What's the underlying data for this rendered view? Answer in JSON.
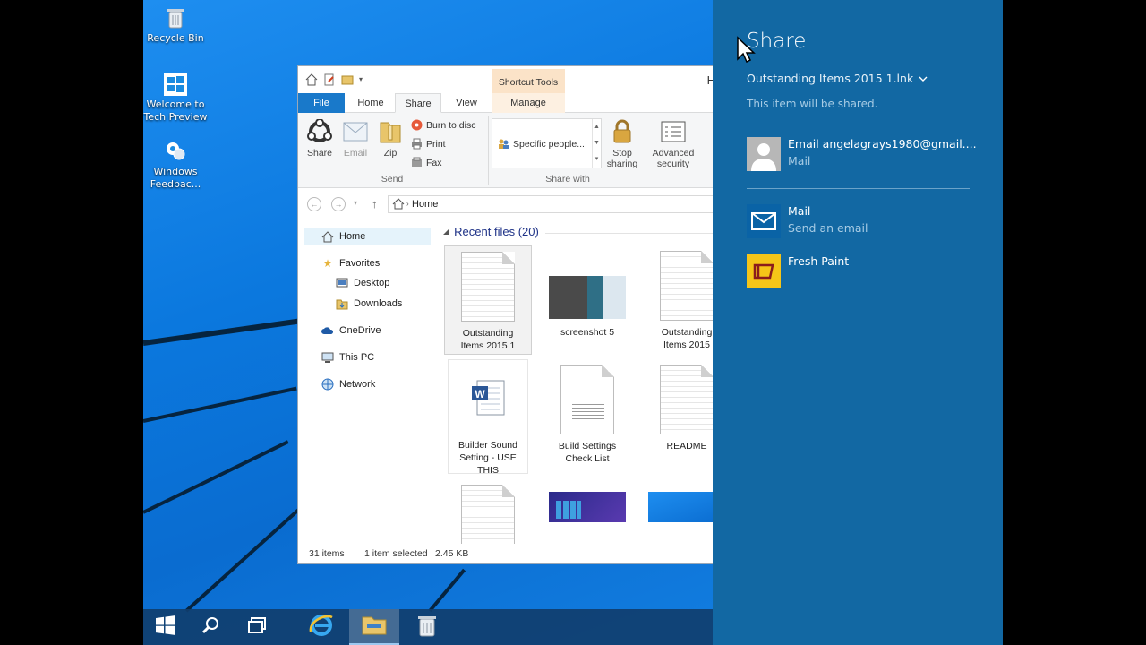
{
  "desktop": {
    "icons": [
      {
        "label": "Recycle Bin",
        "icon": "recycle-bin-icon"
      },
      {
        "label": "Welcome to Tech Preview",
        "icon": "windows-logo-icon"
      },
      {
        "label": "Windows Feedbac...",
        "icon": "feedback-icon"
      }
    ]
  },
  "explorer": {
    "context_tab": "Shortcut Tools",
    "title_partial": "H",
    "tabs": {
      "file": "File",
      "home": "Home",
      "share": "Share",
      "view": "View",
      "manage": "Manage"
    },
    "ribbon": {
      "share": "Share",
      "email": "Email",
      "zip": "Zip",
      "burn": "Burn to disc",
      "print": "Print",
      "fax": "Fax",
      "send_group": "Send",
      "specific_people": "Specific people...",
      "share_with_group": "Share with",
      "stop_sharing_1": "Stop",
      "stop_sharing_2": "sharing",
      "advanced_1": "Advanced",
      "advanced_2": "security"
    },
    "address": "Home",
    "nav": {
      "home": "Home",
      "favorites": "Favorites",
      "desktop": "Desktop",
      "downloads": "Downloads",
      "onedrive": "OneDrive",
      "this_pc": "This PC",
      "network": "Network"
    },
    "group_title": "Recent files (20)",
    "files": [
      {
        "line1": "Outstanding",
        "line2": "Items 2015 1",
        "line3": ""
      },
      {
        "line1": "screenshot 5",
        "line2": "",
        "line3": ""
      },
      {
        "line1": "Outstanding",
        "line2": "Items 2015",
        "line3": ""
      },
      {
        "line1": "Builder Sound",
        "line2": "Setting - USE",
        "line3": "THIS"
      },
      {
        "line1": "Build Settings",
        "line2": "Check List",
        "line3": ""
      },
      {
        "line1": "README",
        "line2": "",
        "line3": ""
      }
    ],
    "status": {
      "count": "31 items",
      "selected": "1 item selected",
      "size": "2.45 KB"
    }
  },
  "charm": {
    "title": "Share",
    "file": "Outstanding Items 2015 1.lnk",
    "note": "This item will be shared.",
    "targets": [
      {
        "line1": "Email angelagrays1980@gmail....",
        "line2": "Mail",
        "tile_color": "#ffffff"
      },
      {
        "line1": "Mail",
        "line2": "Send an email",
        "tile_color": "#0a63a6"
      },
      {
        "line1": "Fresh Paint",
        "line2": "",
        "tile_color": "#f5c518"
      }
    ]
  },
  "colors": {
    "accent": "#1268a3",
    "file_tab": "#1979ca",
    "context_tab": "#fbe3c8",
    "taskbar": "#103e6e"
  }
}
